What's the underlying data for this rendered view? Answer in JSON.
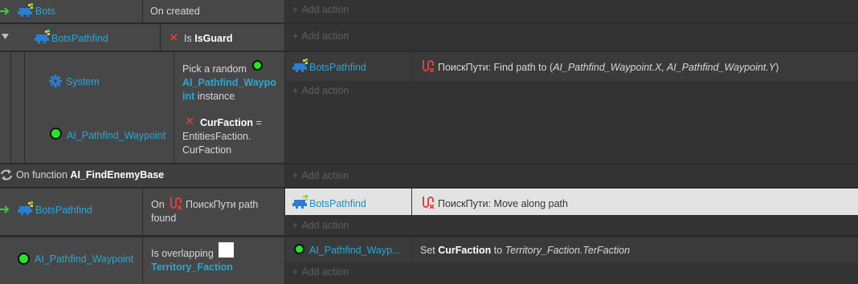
{
  "rows": {
    "bots_event": {
      "object": "Bots",
      "condition": "On created",
      "add_action": "Add action"
    },
    "botspathfind_sub": {
      "object": "BotsPathfind",
      "cond_prefix": "Is",
      "cond_name": "IsGuard",
      "add_action": "Add action"
    },
    "system_sub": {
      "system_object": "System",
      "pick_line1": "Pick a random",
      "pick_obj_a": "AI_Pathfind_Waypo",
      "pick_obj_b": "int",
      "pick_tail": "instance",
      "waypoint_object": "AI_Pathfind_Waypoint",
      "cf_name": "CurFaction",
      "cf_eq": "=",
      "cf_line2": "EntitiesFaction.",
      "cf_line3": "CurFaction",
      "action_object": "BotsPathfind",
      "action_text_prefix": "ПоискПути: Find path to (",
      "action_text_args": "AI_Pathfind_Waypoint.X, AI_Pathfind_Waypoint.Y",
      "action_text_suffix": ")",
      "add_action": "Add action"
    },
    "function": {
      "prefix": "On function",
      "name": "AI_FindEnemyBase",
      "add_action": "Add action"
    },
    "path_found": {
      "object": "BotsPathfind",
      "cond_on": "On",
      "cond_text": "ПоискПути path",
      "cond_text2": "found",
      "action_object": "BotsPathfind",
      "action_text": "ПоискПути: Move along path",
      "add_action": "Add action"
    },
    "overlap": {
      "object": "AI_Pathfind_Waypoint",
      "cond_text": "Is overlapping",
      "cond_obj": "Territory_Faction",
      "action_object": "AI_Pathfind_Wayp...",
      "action_set": "Set",
      "action_var": "CurFaction",
      "action_to": "to",
      "action_expr": "Territory_Faction.TerFaction",
      "add_action": "Add action"
    }
  },
  "colors": {
    "object": "#29a8d6",
    "green": "#29e32a",
    "red_icon": "#e04040"
  }
}
